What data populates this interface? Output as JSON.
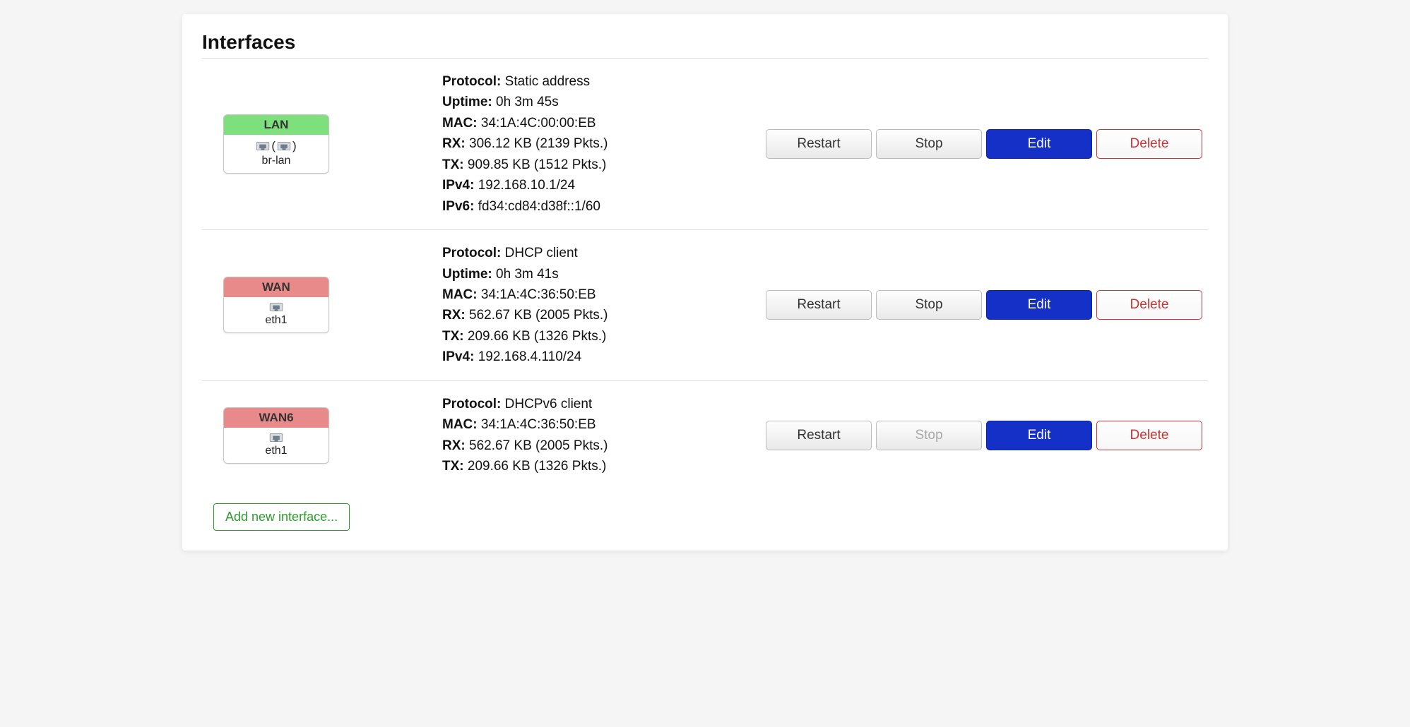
{
  "page_title": "Interfaces",
  "labels": {
    "protocol": "Protocol:",
    "uptime": "Uptime:",
    "mac": "MAC:",
    "rx": "RX:",
    "tx": "TX:",
    "ipv4": "IPv4:",
    "ipv6": "IPv6:"
  },
  "buttons": {
    "restart": "Restart",
    "stop": "Stop",
    "edit": "Edit",
    "delete": "Delete",
    "add": "Add new interface..."
  },
  "interfaces": [
    {
      "name": "LAN",
      "zone_color": "green",
      "device": "br-lan",
      "multi_port": true,
      "protocol": "Static address",
      "uptime": "0h 3m 45s",
      "mac": "34:1A:4C:00:00:EB",
      "rx": "306.12 KB (2139 Pkts.)",
      "tx": "909.85 KB (1512 Pkts.)",
      "ipv4": "192.168.10.1/24",
      "ipv6": "fd34:cd84:d38f::1/60",
      "stop_disabled": false
    },
    {
      "name": "WAN",
      "zone_color": "red",
      "device": "eth1",
      "multi_port": false,
      "protocol": "DHCP client",
      "uptime": "0h 3m 41s",
      "mac": "34:1A:4C:36:50:EB",
      "rx": "562.67 KB (2005 Pkts.)",
      "tx": "209.66 KB (1326 Pkts.)",
      "ipv4": "192.168.4.110/24",
      "ipv6": null,
      "stop_disabled": false
    },
    {
      "name": "WAN6",
      "zone_color": "red",
      "device": "eth1",
      "multi_port": false,
      "protocol": "DHCPv6 client",
      "uptime": null,
      "mac": "34:1A:4C:36:50:EB",
      "rx": "562.67 KB (2005 Pkts.)",
      "tx": "209.66 KB (1326 Pkts.)",
      "ipv4": null,
      "ipv6": null,
      "stop_disabled": true
    }
  ]
}
